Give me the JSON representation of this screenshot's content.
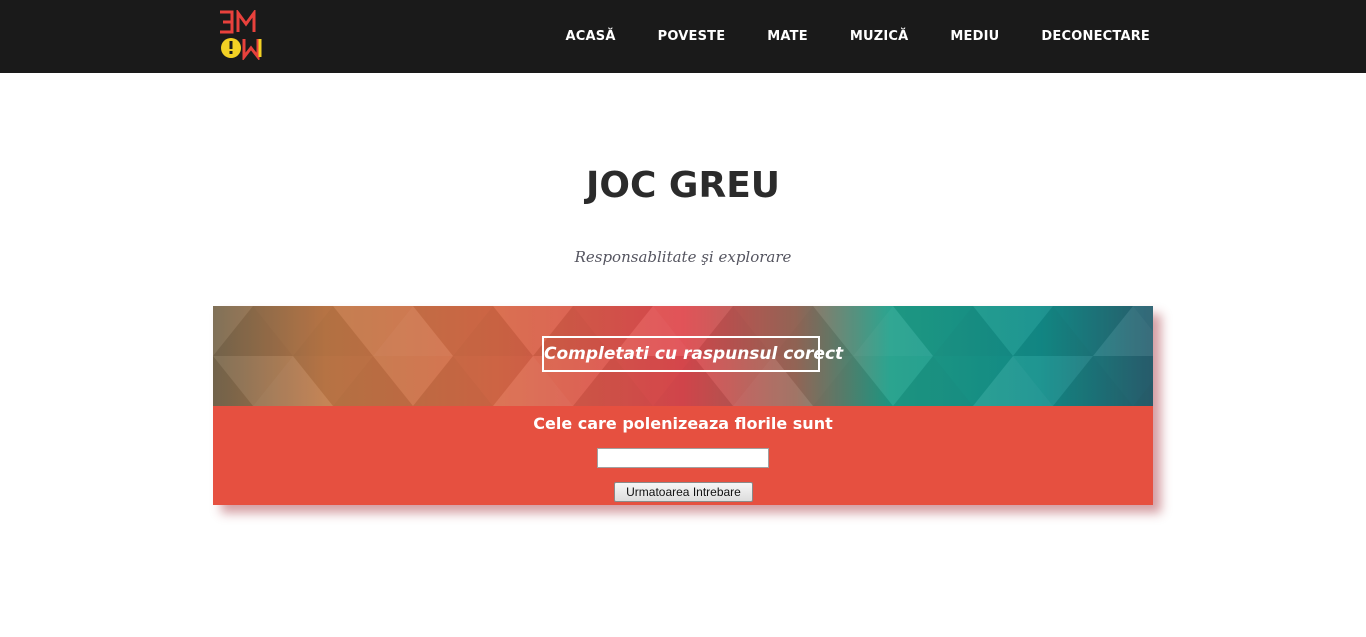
{
  "logo": {
    "text_top": "3M",
    "text_bottom": "OW",
    "colors": [
      "#e8413c",
      "#f2d024"
    ]
  },
  "nav": {
    "items": [
      {
        "label": "ACASĂ"
      },
      {
        "label": "POVESTE"
      },
      {
        "label": "MATE"
      },
      {
        "label": "MUZICĂ"
      },
      {
        "label": "MEDIU"
      },
      {
        "label": "DECONECTARE"
      }
    ]
  },
  "header": {
    "title": "JOC GREU",
    "subtitle": "Responsablitate şi explorare"
  },
  "quiz": {
    "banner_heading": "Completati cu raspunsul corect",
    "question": "Cele care polenizeaza florile sunt",
    "answer_value": "",
    "next_button_label": "Urmatoarea Intrebare"
  },
  "colors": {
    "navbar": "#1a1a1a",
    "quiz_body": "#e65040",
    "banner_gradient": [
      "#7a6a50",
      "#d07040",
      "#e25048",
      "#e04050",
      "#20a090",
      "#158a8a",
      "#2a6070"
    ]
  }
}
